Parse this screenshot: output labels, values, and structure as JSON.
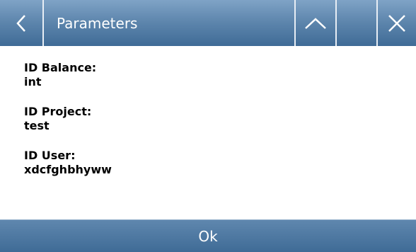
{
  "header": {
    "title": "Parameters",
    "icons": {
      "back": "chevron-left-icon",
      "up": "chevron-up-icon",
      "close": "close-icon"
    }
  },
  "fields": [
    {
      "label": "ID Balance:",
      "value": "int"
    },
    {
      "label": "ID Project:",
      "value": "test"
    },
    {
      "label": "ID User:",
      "value": "xdcfghbhyww"
    }
  ],
  "footer": {
    "ok_label": "Ok"
  },
  "colors": {
    "bar_top": "#7fa3c6",
    "bar_bottom": "#3f6b96",
    "separator": "#e8eef5",
    "text": "#000000"
  }
}
